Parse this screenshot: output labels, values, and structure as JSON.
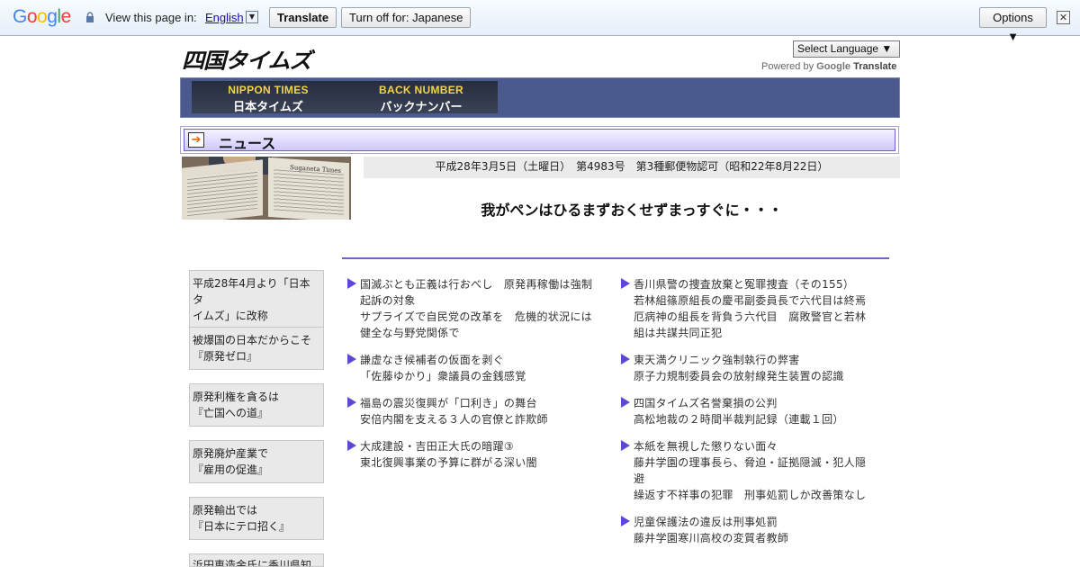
{
  "translate_bar": {
    "logo": "Google",
    "view_text": "View this page in:",
    "language": "English",
    "translate_label": "Translate",
    "turnoff_label": "Turn off for: Japanese",
    "options_label": "Options ▼",
    "close_glyph": "✕"
  },
  "site": {
    "logo": "四国タイムズ",
    "select_language": "Select Language ▼",
    "powered_by": "Powered by",
    "google": "Google",
    "translate": "Translate"
  },
  "banner": {
    "nav1_en": "NIPPON TIMES",
    "nav1_jp": "日本タイムズ",
    "nav2_en": "BACK NUMBER",
    "nav2_jp": "バックナンバー"
  },
  "news_heading": "ニュース",
  "photo_caption": "Suganeta Times",
  "dateline": "平成28年3月5日（土曜日）　第4983号　第3種郵便物認可（昭和22年8月22日）",
  "motto": "我がペンはひるまずおくせずまっすぐに・・・",
  "sidebar": [
    {
      "line1": "平成28年4月より「日本タ",
      "line2": "イムズ」に改称"
    },
    {
      "line1": "被爆国の日本だからこそ",
      "line2": "『原発ゼロ』"
    },
    {
      "line1": "原発利権を貪るは",
      "line2": "『亡国への道』"
    },
    {
      "line1": "原発廃炉産業で",
      "line2": "『雇用の促進』"
    },
    {
      "line1": "原発輸出では",
      "line2": "『日本にテロ招く』"
    },
    {
      "line1": "浜田恵造金氏に香川県知事",
      "line2": ""
    }
  ],
  "articles_left": [
    {
      "lines": [
        "国滅ぶとも正義は行おべし　原発再稼働は強制",
        "起訴の対象",
        "サプライズで自民党の改革を　危機的状況には",
        "健全な与野党関係で"
      ]
    },
    {
      "lines": [
        "謙虚なき候補者の仮面を剥ぐ",
        "「佐藤ゆかり」衆議員の金銭感覚"
      ]
    },
    {
      "lines": [
        "福島の震災復興が「口利き」の舞台",
        "安倍内閣を支える３人の官僚と詐欺師"
      ]
    },
    {
      "lines": [
        "大成建設・吉田正大氏の暗躍③",
        "東北復興事業の予算に群がる深い闇"
      ]
    }
  ],
  "articles_right": [
    {
      "lines": [
        "香川県警の捜査放棄と冤罪捜査（その155）",
        "若林組篠原組長の慶弔副委員長で六代目は終焉",
        "厄病神の組長を背負う六代目　腐敗警官と若林",
        "組は共謀共同正犯"
      ]
    },
    {
      "lines": [
        "東天満クリニック強制執行の弊害",
        "原子力規制委員会の放射線発生装置の認識"
      ]
    },
    {
      "lines": [
        "四国タイムズ名誉棄損の公判",
        "高松地裁の２時間半裁判記録（連載１回）"
      ]
    },
    {
      "lines": [
        "本紙を無視した懲りない面々",
        "藤井学園の理事長ら、脅迫・証拠隠滅・犯人隠",
        "避",
        "繰返す不祥事の犯罪　刑事処罰しか改善策なし"
      ]
    },
    {
      "lines": [
        "児童保護法の違反は刑事処罰",
        "藤井学園寒川高校の変質者教師"
      ]
    }
  ]
}
